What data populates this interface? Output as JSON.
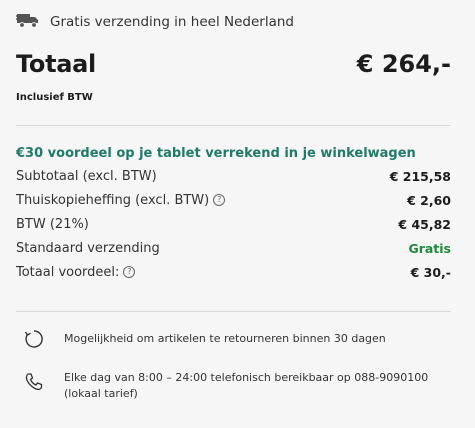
{
  "shipping": {
    "icon": "truck-icon",
    "text": "Gratis verzending in heel Nederland"
  },
  "total": {
    "label": "Totaal",
    "value": "€ 264,-",
    "vat_note": "Inclusief BTW"
  },
  "promo": "€30 voordeel op je tablet verrekend in je winkelwagen",
  "rows": [
    {
      "label": "Subtotaal (excl. BTW)",
      "value": "€ 215,58"
    },
    {
      "label": "Thuiskopieheffing (excl. BTW)",
      "value": "€ 2,60",
      "info": "?"
    },
    {
      "label": "BTW (21%)",
      "value": "€ 45,82"
    },
    {
      "label": "Standaard verzending",
      "value": "Gratis"
    },
    {
      "label": "Totaal voordeel:",
      "value": "€ 30,-",
      "info": "?"
    }
  ],
  "services": [
    {
      "icon": "return-icon",
      "text": "Mogelijkheid om artikelen te retourneren binnen 30 dagen"
    },
    {
      "icon": "phone-icon",
      "text": "Elke dag van 8:00 – 24:00 telefonisch bereikbaar op 088-9090100 (lokaal tarief)"
    }
  ],
  "colors": {
    "promo": "#1f7a6a",
    "free": "#1f8a3c"
  }
}
